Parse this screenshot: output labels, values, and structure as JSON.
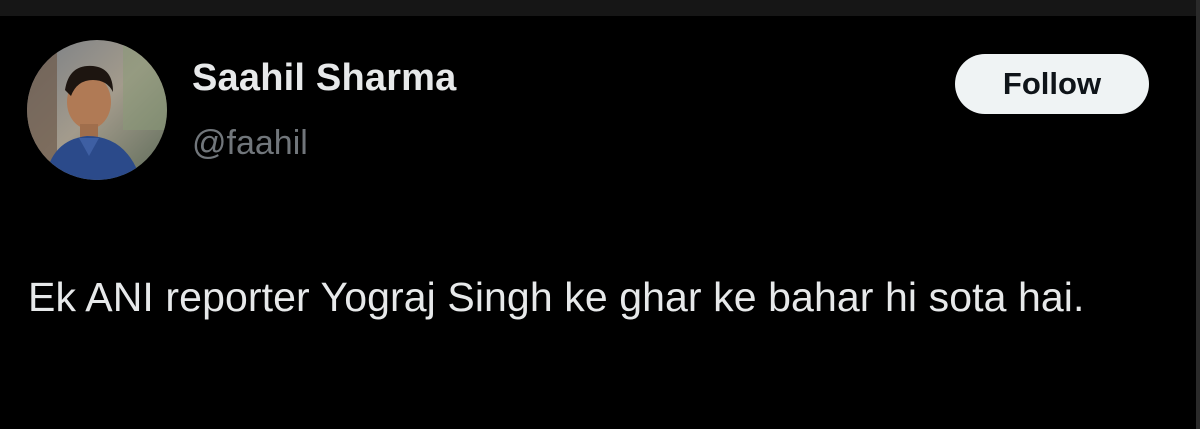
{
  "tweet": {
    "author": {
      "display_name": "Saahil Sharma",
      "handle": "@faahil",
      "avatar": "avatar-photo"
    },
    "follow_button": {
      "label": "Follow"
    },
    "text": "Ek ANI reporter Yograj Singh ke ghar ke bahar hi sota hai."
  },
  "colors": {
    "background": "#000000",
    "primary_text": "#e7e9ea",
    "secondary_text": "#71767b",
    "button_bg": "#eff3f4",
    "button_text": "#0f1419"
  }
}
